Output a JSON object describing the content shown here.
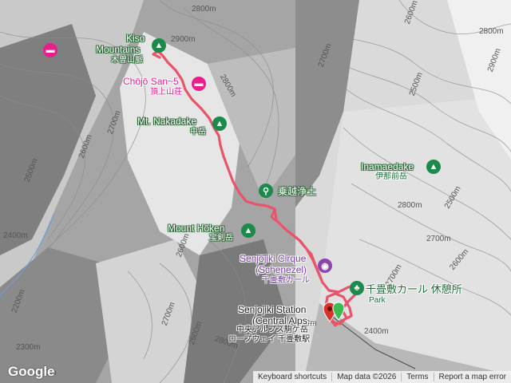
{
  "map": {
    "route_color": "#e8556b",
    "contour_labels": [
      "2800m",
      "2900m",
      "2700m",
      "2600m",
      "2500m",
      "2400m",
      "2200m",
      "2300m",
      "2700m",
      "2800m",
      "2600m",
      "2500m",
      "2700m",
      "2800m",
      "2900m",
      "2600m",
      "2500m",
      "2700m",
      "2600m",
      "2800m",
      "2400m",
      "2700m",
      "2600m",
      "2800m",
      "2400m",
      "2500m"
    ],
    "places": {
      "kiso_en": "Kiso",
      "kiso_en2": "Mountains",
      "kiso_jp": "木曽山脈",
      "chojo_en": "Chōjō San~5",
      "chojo_jp": "頂上山荘",
      "nakadake_en": "Mt. Nakadake",
      "nakadake_jp": "中岳",
      "norikoshi_jp": "乗越浄土",
      "inamaedake_en": "Inamaedake",
      "inamaedake_jp": "伊那前岳",
      "hoken_en": "Mount Hōken",
      "hoken_jp": "宝剣岳",
      "cirque_en": "Senjōjiki Cirque",
      "cirque_en2": "(Schenezel)",
      "cirque_jp": "千畳敷カール",
      "rest_jp": "千畳敷カール 休憩所",
      "rest_en": "Park",
      "station_en": "Senjojiki Station",
      "station_en2": "(Central Alps...",
      "station_jp": "中央アルプス駒ケ岳",
      "station_jp2": "ロープウェイ 千畳敷駅"
    },
    "icons": {
      "peak": "mountain-icon",
      "hotel": "hotel-icon",
      "hike": "hiking-icon",
      "attraction": "camera-icon",
      "marker": "map-pin-icon"
    }
  },
  "branding": {
    "logo": "Google"
  },
  "attribution": {
    "shortcuts": "Keyboard shortcuts",
    "data": "Map data ©2026",
    "terms": "Terms",
    "report": "Report a map error"
  }
}
